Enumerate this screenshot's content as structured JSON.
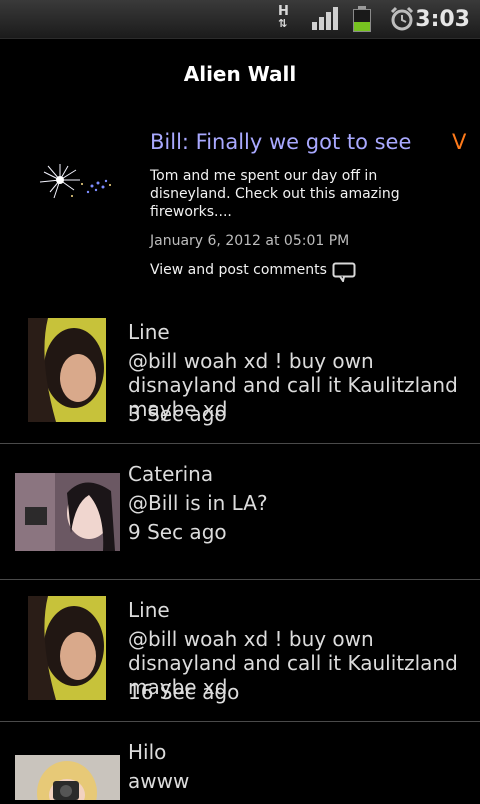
{
  "status_bar": {
    "network": "H",
    "time": "3:03"
  },
  "header": {
    "title": "Alien Wall"
  },
  "post": {
    "heading": "Bill: Finally we got to see",
    "flag": "V",
    "body": "Tom and me spent our day off in disneyland. Check out this amazing fireworks....",
    "date": "January 6, 2012 at 05:01 PM",
    "comments_link": "View and post comments"
  },
  "comments": [
    {
      "name": "Line",
      "text": "@bill woah xd ! buy own disnayland and call it Kaulitzland maybe xd",
      "time": "3 Sec ago"
    },
    {
      "name": "Caterina",
      "text": "@Bill is in LA?",
      "time": "9 Sec ago"
    },
    {
      "name": "Line",
      "text": "@bill woah xd ! buy own disnayland and call it Kaulitzland maybe xd",
      "time": "16 Sec ago"
    },
    {
      "name": "Hilo",
      "text": "awww",
      "time": ""
    }
  ],
  "colors": {
    "heading": "#a9a9ff",
    "flag": "#ff7a1a",
    "battery": "#77c320"
  }
}
